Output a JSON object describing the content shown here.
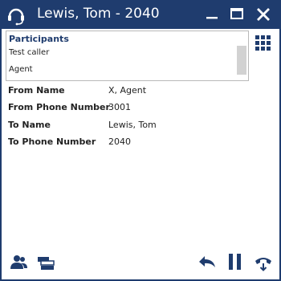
{
  "window": {
    "title": "Lewis, Tom - 2040",
    "app_icon": "headset-icon",
    "controls": [
      "minimize-icon",
      "maximize-icon",
      "close-icon"
    ]
  },
  "participants": {
    "title": "Participants",
    "items": [
      "Test caller",
      "Agent"
    ]
  },
  "details": [
    {
      "label": "From Name",
      "value": "X, Agent"
    },
    {
      "label": "From Phone Number",
      "value": "3001"
    },
    {
      "label": "To Name",
      "value": "Lewis, Tom"
    },
    {
      "label": "To Phone Number",
      "value": "2040"
    }
  ],
  "toolbar": {
    "left_icons": [
      "contacts-icon",
      "queue-icon"
    ],
    "right_icons": [
      "reply-icon",
      "hold-icon",
      "hangup-icon"
    ],
    "dialpad_icon": "dialpad-grid-icon"
  },
  "colors": {
    "accent": "#1f3c6e",
    "background": "#ffffff",
    "border": "#b9b9b9"
  }
}
